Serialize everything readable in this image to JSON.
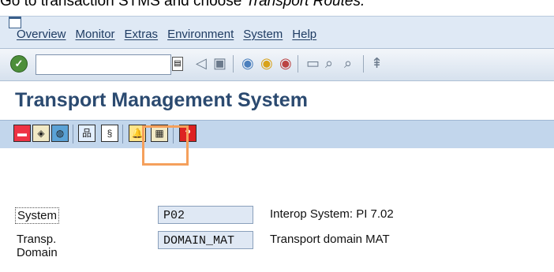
{
  "caption": {
    "prefix": "Go to transaction STMS and choose ",
    "emphasis": "Transport Routes."
  },
  "menu": {
    "items": [
      "Overview",
      "Monitor",
      "Extras",
      "Environment",
      "System",
      "Help"
    ]
  },
  "toolbar": {
    "command_value": "",
    "command_placeholder": ""
  },
  "page_title": "Transport Management System",
  "fields": {
    "system": {
      "label": "System",
      "value": "P02",
      "description": "Interop System: PI 7.02"
    },
    "domain": {
      "label": "Transp. Domain",
      "value": "DOMAIN_MAT",
      "description": "Transport domain MAT"
    }
  },
  "colors": {
    "highlight": "#f5a05c",
    "title": "#2b4a70",
    "app_toolbar": "#c2d6ec"
  }
}
